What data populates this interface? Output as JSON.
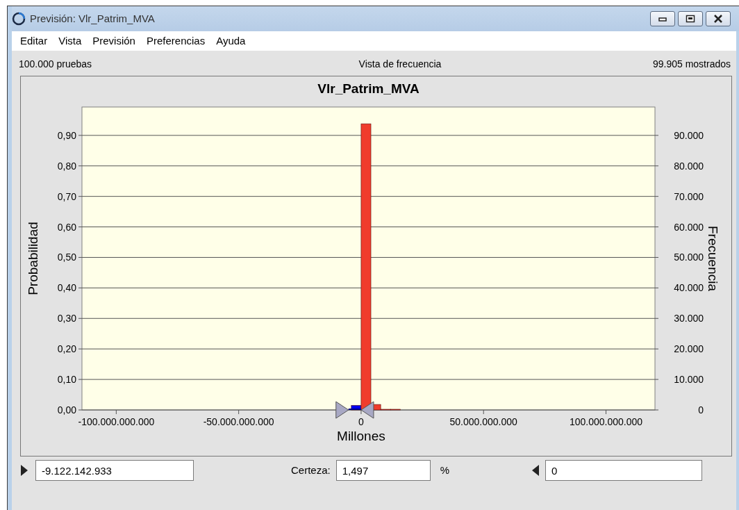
{
  "window": {
    "title": "Previsión: Vlr_Patrim_MVA"
  },
  "menu": [
    "Editar",
    "Vista",
    "Previsión",
    "Preferencias",
    "Ayuda"
  ],
  "header": {
    "trials": "100.000 pruebas",
    "view": "Vista de frecuencia",
    "shown": "99.905 mostrados"
  },
  "chart": {
    "right_axis": {
      "label": "Frecuencia",
      "ticks": [
        "90.000",
        "80.000",
        "70.000",
        "60.000",
        "50.000",
        "40.000",
        "30.000",
        "20.000",
        "10.000",
        "0"
      ]
    },
    "chart_data": {
      "type": "bar",
      "title": "Vlr_Patrim_MVA",
      "xlabel": "Millones",
      "ylabel": "Probabilidad",
      "x": [
        -2000000000,
        2000000000,
        6000000000,
        10000000000,
        14000000000
      ],
      "series": [
        {
          "color": "#0000ee",
          "values": [
            0.015,
            null,
            null,
            null,
            null
          ]
        },
        {
          "color": "#f03c2c",
          "values": [
            null,
            0.938,
            0.018,
            0.002,
            0.001
          ]
        }
      ],
      "stacked": true,
      "grid": true,
      "xlim": [
        -114000000000,
        120000000000
      ],
      "ylim": [
        0,
        0.993
      ],
      "xticks": [
        {
          "value": -100000000000,
          "label": "-100.000.000.000"
        },
        {
          "value": -50000000000,
          "label": "-50.000.000.000"
        },
        {
          "value": 0,
          "label": "0"
        },
        {
          "value": 50000000000,
          "label": "50.000.000.000"
        },
        {
          "value": 100000000000,
          "label": "100.000.000.000"
        }
      ],
      "yticks": [
        {
          "value": 0,
          "label": "0,00"
        },
        {
          "value": 0.1,
          "label": "0,10"
        },
        {
          "value": 0.2,
          "label": "0,20"
        },
        {
          "value": 0.3,
          "label": "0,30"
        },
        {
          "value": 0.4,
          "label": "0,40"
        },
        {
          "value": 0.5,
          "label": "0,50"
        },
        {
          "value": 0.6,
          "label": "0,60"
        },
        {
          "value": 0.7,
          "label": "0,70"
        },
        {
          "value": 0.8,
          "label": "0,80"
        },
        {
          "value": 0.9,
          "label": "0,90"
        }
      ]
    }
  },
  "certainty": {
    "lower": "-9.122.142.933",
    "label": "Certeza:",
    "value": "1,497",
    "unit": "%",
    "upper": "0"
  }
}
